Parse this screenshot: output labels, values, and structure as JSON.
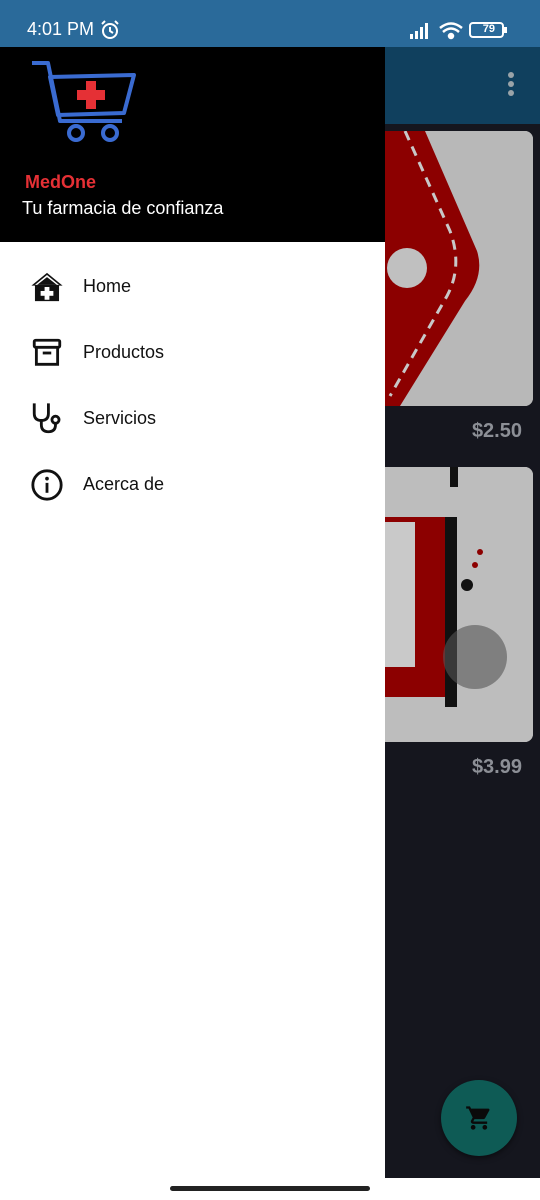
{
  "status_bar": {
    "time": "4:01 PM",
    "battery": "79",
    "icons": [
      "alarm-icon",
      "signal-icon",
      "wifi-icon",
      "battery-icon"
    ]
  },
  "drawer": {
    "brand": "MedOne",
    "tagline": "Tu farmacia de confianza",
    "logo": "medical-cart-logo",
    "items": [
      {
        "label": "Home",
        "icon": "home-plus-icon"
      },
      {
        "label": "Productos",
        "icon": "archive-box-icon"
      },
      {
        "label": "Servicios",
        "icon": "stethoscope-icon"
      },
      {
        "label": "Acerca de",
        "icon": "info-icon"
      }
    ]
  },
  "background": {
    "products": [
      {
        "price": "$2.50"
      },
      {
        "price": "$3.99"
      }
    ],
    "fab_icon": "shopping-cart-icon",
    "menu_icon": "more-vert-icon"
  },
  "colors": {
    "status_bar": "#2a6a9a",
    "brand_red": "#e53035",
    "header": "#000000",
    "fab": "#0e5b55"
  }
}
